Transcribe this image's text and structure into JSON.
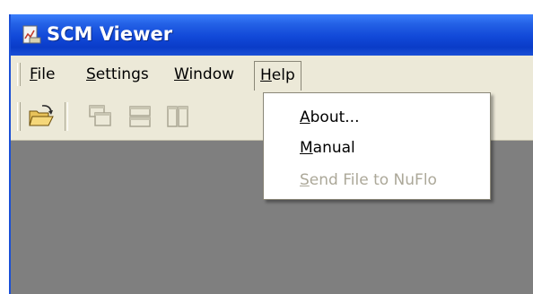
{
  "window": {
    "title": "SCM Viewer",
    "icon": "chart-document-icon",
    "titlebar_color": "#1148d8"
  },
  "menubar": {
    "items": [
      {
        "acc": "F",
        "rest": "ile",
        "open": false
      },
      {
        "acc": "S",
        "rest": "ettings",
        "open": false
      },
      {
        "acc": "W",
        "rest": "indow",
        "open": false
      },
      {
        "acc": "H",
        "rest": "elp",
        "open": true
      }
    ]
  },
  "toolbar": {
    "buttons": [
      {
        "icon": "open-folder-icon",
        "enabled": true
      },
      {
        "icon": "cascade-windows-icon",
        "enabled": false
      },
      {
        "icon": "tile-horizontal-icon",
        "enabled": false
      },
      {
        "icon": "tile-vertical-icon",
        "enabled": false
      }
    ]
  },
  "help_menu": {
    "items": [
      {
        "acc": "A",
        "rest": "bout...",
        "enabled": true
      },
      {
        "acc": "M",
        "rest": "anual",
        "enabled": true
      },
      {
        "acc": "S",
        "rest": "end File to NuFlo",
        "enabled": false
      }
    ]
  }
}
